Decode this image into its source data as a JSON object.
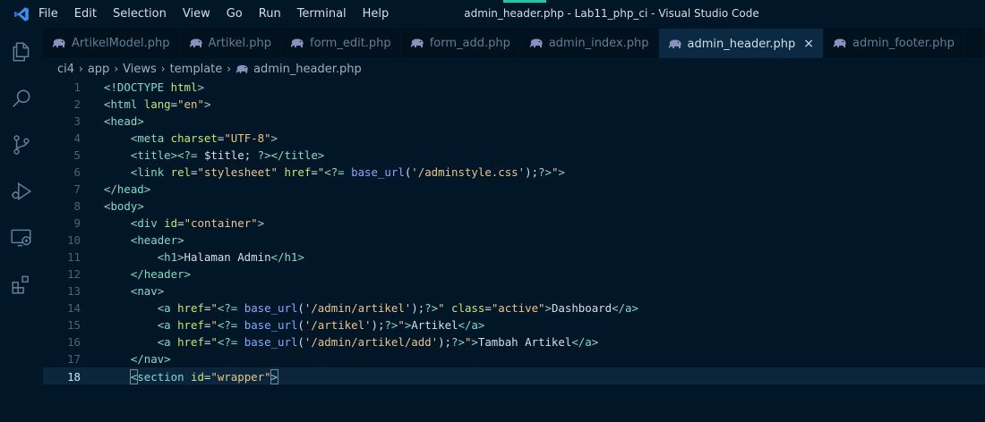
{
  "menu": [
    "File",
    "Edit",
    "Selection",
    "View",
    "Go",
    "Run",
    "Terminal",
    "Help"
  ],
  "window_title": "admin_header.php - Lab11_php_ci - Visual Studio Code",
  "tabs": [
    {
      "label": "ArtikelModel.php",
      "active": false
    },
    {
      "label": "Artikel.php",
      "active": false
    },
    {
      "label": "form_edit.php",
      "active": false
    },
    {
      "label": "form_add.php",
      "active": false
    },
    {
      "label": "admin_index.php",
      "active": false
    },
    {
      "label": "admin_header.php",
      "active": true
    },
    {
      "label": "admin_footer.php",
      "active": false
    }
  ],
  "close_glyph": "×",
  "breadcrumb": [
    "ci4",
    "app",
    "Views",
    "template",
    "admin_header.php"
  ],
  "breadcrumb_sep": "›",
  "activity_icons": [
    "explorer-icon",
    "search-icon",
    "source-control-icon",
    "run-debug-icon",
    "remote-explorer-icon",
    "extensions-icon"
  ],
  "current_line": 18,
  "code": [
    {
      "n": "1",
      "tokens": [
        [
          "tg",
          "<!"
        ],
        [
          "tn",
          "DOCTYPE"
        ],
        [
          "pln",
          " "
        ],
        [
          "attr",
          "html"
        ],
        [
          "tg",
          ">"
        ]
      ]
    },
    {
      "n": "2",
      "tokens": [
        [
          "tg",
          "<"
        ],
        [
          "tn",
          "html"
        ],
        [
          "pln",
          " "
        ],
        [
          "attr",
          "lang"
        ],
        [
          "pln",
          "="
        ],
        [
          "str",
          "\"en\""
        ],
        [
          "tg",
          ">"
        ]
      ]
    },
    {
      "n": "3",
      "tokens": [
        [
          "tg",
          "<"
        ],
        [
          "tn",
          "head"
        ],
        [
          "tg",
          ">"
        ]
      ]
    },
    {
      "n": "4",
      "tokens": [
        [
          "pln",
          "    "
        ],
        [
          "tg",
          "<"
        ],
        [
          "tn",
          "meta"
        ],
        [
          "pln",
          " "
        ],
        [
          "attr",
          "charset"
        ],
        [
          "pln",
          "="
        ],
        [
          "str",
          "\"UTF-8\""
        ],
        [
          "tg",
          ">"
        ]
      ]
    },
    {
      "n": "5",
      "tokens": [
        [
          "pln",
          "    "
        ],
        [
          "tg",
          "<"
        ],
        [
          "tn",
          "title"
        ],
        [
          "tg",
          ">"
        ],
        [
          "php",
          "<?="
        ],
        [
          "pln",
          " "
        ],
        [
          "var",
          "$title"
        ],
        [
          "pln",
          "; "
        ],
        [
          "php",
          "?>"
        ],
        [
          "tg",
          "</"
        ],
        [
          "tn",
          "title"
        ],
        [
          "tg",
          ">"
        ]
      ]
    },
    {
      "n": "6",
      "tokens": [
        [
          "pln",
          "    "
        ],
        [
          "tg",
          "<"
        ],
        [
          "tn",
          "link"
        ],
        [
          "pln",
          " "
        ],
        [
          "attr",
          "rel"
        ],
        [
          "pln",
          "="
        ],
        [
          "str",
          "\"stylesheet\""
        ],
        [
          "pln",
          " "
        ],
        [
          "attr",
          "href"
        ],
        [
          "pln",
          "="
        ],
        [
          "str",
          "\""
        ],
        [
          "php",
          "<?="
        ],
        [
          "pln",
          " "
        ],
        [
          "fn",
          "base_url"
        ],
        [
          "pln",
          "("
        ],
        [
          "str",
          "'/adminstyle.css'"
        ],
        [
          "pln",
          ");"
        ],
        [
          "php",
          "?>"
        ],
        [
          "str",
          "\""
        ],
        [
          "tg",
          ">"
        ]
      ]
    },
    {
      "n": "7",
      "tokens": [
        [
          "tg",
          "</"
        ],
        [
          "tn",
          "head"
        ],
        [
          "tg",
          ">"
        ]
      ]
    },
    {
      "n": "8",
      "tokens": [
        [
          "tg",
          "<"
        ],
        [
          "tn",
          "body"
        ],
        [
          "tg",
          ">"
        ]
      ]
    },
    {
      "n": "9",
      "tokens": [
        [
          "pln",
          "    "
        ],
        [
          "tg",
          "<"
        ],
        [
          "tn",
          "div"
        ],
        [
          "pln",
          " "
        ],
        [
          "attr",
          "id"
        ],
        [
          "pln",
          "="
        ],
        [
          "str",
          "\"container\""
        ],
        [
          "tg",
          ">"
        ]
      ]
    },
    {
      "n": "10",
      "tokens": [
        [
          "pln",
          "    "
        ],
        [
          "tg",
          "<"
        ],
        [
          "tn",
          "header"
        ],
        [
          "tg",
          ">"
        ]
      ]
    },
    {
      "n": "11",
      "tokens": [
        [
          "pln",
          "        "
        ],
        [
          "tg",
          "<"
        ],
        [
          "tn",
          "h1"
        ],
        [
          "tg",
          ">"
        ],
        [
          "txt",
          "Halaman Admin"
        ],
        [
          "tg",
          "</"
        ],
        [
          "tn",
          "h1"
        ],
        [
          "tg",
          ">"
        ]
      ]
    },
    {
      "n": "12",
      "tokens": [
        [
          "pln",
          "    "
        ],
        [
          "tg",
          "</"
        ],
        [
          "tn",
          "header"
        ],
        [
          "tg",
          ">"
        ]
      ]
    },
    {
      "n": "13",
      "tokens": [
        [
          "pln",
          "    "
        ],
        [
          "tg",
          "<"
        ],
        [
          "tn",
          "nav"
        ],
        [
          "tg",
          ">"
        ]
      ]
    },
    {
      "n": "14",
      "tokens": [
        [
          "pln",
          "        "
        ],
        [
          "tg",
          "<"
        ],
        [
          "tn",
          "a"
        ],
        [
          "pln",
          " "
        ],
        [
          "attr",
          "href"
        ],
        [
          "pln",
          "="
        ],
        [
          "str",
          "\""
        ],
        [
          "php",
          "<?="
        ],
        [
          "pln",
          " "
        ],
        [
          "fn",
          "base_url"
        ],
        [
          "pln",
          "("
        ],
        [
          "str",
          "'/admin/artikel'"
        ],
        [
          "pln",
          ");"
        ],
        [
          "php",
          "?>"
        ],
        [
          "str",
          "\""
        ],
        [
          "pln",
          " "
        ],
        [
          "attr",
          "class"
        ],
        [
          "pln",
          "="
        ],
        [
          "str",
          "\"active\""
        ],
        [
          "tg",
          ">"
        ],
        [
          "txt",
          "Dashboard"
        ],
        [
          "tg",
          "</"
        ],
        [
          "tn",
          "a"
        ],
        [
          "tg",
          ">"
        ]
      ]
    },
    {
      "n": "15",
      "tokens": [
        [
          "pln",
          "        "
        ],
        [
          "tg",
          "<"
        ],
        [
          "tn",
          "a"
        ],
        [
          "pln",
          " "
        ],
        [
          "attr",
          "href"
        ],
        [
          "pln",
          "="
        ],
        [
          "str",
          "\""
        ],
        [
          "php",
          "<?="
        ],
        [
          "pln",
          " "
        ],
        [
          "fn",
          "base_url"
        ],
        [
          "pln",
          "("
        ],
        [
          "str",
          "'/artikel'"
        ],
        [
          "pln",
          ");"
        ],
        [
          "php",
          "?>"
        ],
        [
          "str",
          "\""
        ],
        [
          "tg",
          ">"
        ],
        [
          "txt",
          "Artikel"
        ],
        [
          "tg",
          "</"
        ],
        [
          "tn",
          "a"
        ],
        [
          "tg",
          ">"
        ]
      ]
    },
    {
      "n": "16",
      "tokens": [
        [
          "pln",
          "        "
        ],
        [
          "tg",
          "<"
        ],
        [
          "tn",
          "a"
        ],
        [
          "pln",
          " "
        ],
        [
          "attr",
          "href"
        ],
        [
          "pln",
          "="
        ],
        [
          "str",
          "\""
        ],
        [
          "php",
          "<?="
        ],
        [
          "pln",
          " "
        ],
        [
          "fn",
          "base_url"
        ],
        [
          "pln",
          "("
        ],
        [
          "str",
          "'/admin/artikel/add'"
        ],
        [
          "pln",
          ");"
        ],
        [
          "php",
          "?>"
        ],
        [
          "str",
          "\""
        ],
        [
          "tg",
          ">"
        ],
        [
          "txt",
          "Tambah Artikel"
        ],
        [
          "tg",
          "</"
        ],
        [
          "tn",
          "a"
        ],
        [
          "tg",
          ">"
        ]
      ]
    },
    {
      "n": "17",
      "tokens": [
        [
          "pln",
          "    "
        ],
        [
          "tg",
          "</"
        ],
        [
          "tn",
          "nav"
        ],
        [
          "tg",
          ">"
        ]
      ]
    },
    {
      "n": "18",
      "tokens": [
        [
          "pln",
          "    "
        ],
        [
          "tg",
          "<"
        ],
        [
          "tn",
          "section"
        ],
        [
          "pln",
          " "
        ],
        [
          "attr",
          "id"
        ],
        [
          "pln",
          "="
        ],
        [
          "str",
          "\"wrapper\""
        ],
        [
          "tg",
          ">"
        ]
      ]
    }
  ],
  "colors": {
    "background": "#011627",
    "tab_inactive": "#01111d",
    "tab_active": "#0b2942",
    "accent": "#21c7a8",
    "php_elephant": "#8892bf"
  }
}
